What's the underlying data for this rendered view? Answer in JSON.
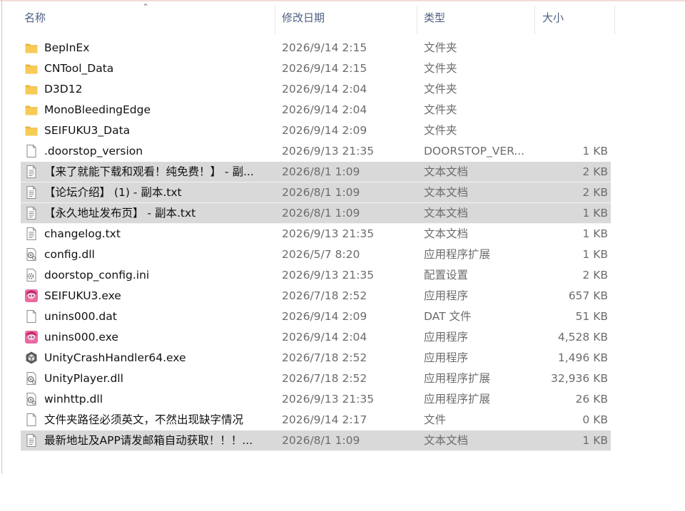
{
  "header": {
    "name": "名称",
    "date": "修改日期",
    "type": "类型",
    "size": "大小"
  },
  "files": [
    {
      "name": "BepInEx",
      "date": "2026/9/14 2:15",
      "type": "文件夹",
      "size": "",
      "icon": "folder-icon",
      "selected": false
    },
    {
      "name": "CNTool_Data",
      "date": "2026/9/14 2:15",
      "type": "文件夹",
      "size": "",
      "icon": "folder-icon",
      "selected": false
    },
    {
      "name": "D3D12",
      "date": "2026/9/14 2:04",
      "type": "文件夹",
      "size": "",
      "icon": "folder-icon",
      "selected": false
    },
    {
      "name": "MonoBleedingEdge",
      "date": "2026/9/14 2:04",
      "type": "文件夹",
      "size": "",
      "icon": "folder-icon",
      "selected": false
    },
    {
      "name": "SEIFUKU3_Data",
      "date": "2026/9/14 2:09",
      "type": "文件夹",
      "size": "",
      "icon": "folder-icon",
      "selected": false
    },
    {
      "name": ".doorstop_version",
      "date": "2026/9/13 21:35",
      "type": "DOORSTOP_VER...",
      "size": "1 KB",
      "icon": "blank-file-icon",
      "selected": false
    },
    {
      "name": "【来了就能下载和观看！纯免费！】 - 副...",
      "date": "2026/8/1 1:09",
      "type": "文本文档",
      "size": "2 KB",
      "icon": "text-file-icon",
      "selected": true
    },
    {
      "name": "【论坛介绍】 (1) - 副本.txt",
      "date": "2026/8/1 1:09",
      "type": "文本文档",
      "size": "2 KB",
      "icon": "text-file-icon",
      "selected": true
    },
    {
      "name": "【永久地址发布页】  - 副本.txt",
      "date": "2026/8/1 1:09",
      "type": "文本文档",
      "size": "1 KB",
      "icon": "text-file-icon",
      "selected": true
    },
    {
      "name": "changelog.txt",
      "date": "2026/9/13 21:35",
      "type": "文本文档",
      "size": "1 KB",
      "icon": "text-file-icon",
      "selected": false
    },
    {
      "name": "config.dll",
      "date": "2026/5/7 8:20",
      "type": "应用程序扩展",
      "size": "1 KB",
      "icon": "dll-file-icon",
      "selected": false
    },
    {
      "name": "doorstop_config.ini",
      "date": "2026/9/13 21:35",
      "type": "配置设置",
      "size": "2 KB",
      "icon": "ini-file-icon",
      "selected": false
    },
    {
      "name": "SEIFUKU3.exe",
      "date": "2026/7/18 2:52",
      "type": "应用程序",
      "size": "657 KB",
      "icon": "app-anime-icon",
      "selected": false
    },
    {
      "name": "unins000.dat",
      "date": "2026/9/14 2:09",
      "type": "DAT 文件",
      "size": "51 KB",
      "icon": "blank-file-icon",
      "selected": false
    },
    {
      "name": "unins000.exe",
      "date": "2026/9/14 2:04",
      "type": "应用程序",
      "size": "4,528 KB",
      "icon": "app-anime-icon",
      "selected": false
    },
    {
      "name": "UnityCrashHandler64.exe",
      "date": "2026/7/18 2:52",
      "type": "应用程序",
      "size": "1,496 KB",
      "icon": "unity-icon",
      "selected": false
    },
    {
      "name": "UnityPlayer.dll",
      "date": "2026/7/18 2:52",
      "type": "应用程序扩展",
      "size": "32,936 KB",
      "icon": "dll-file-icon",
      "selected": false
    },
    {
      "name": "winhttp.dll",
      "date": "2026/9/13 21:35",
      "type": "应用程序扩展",
      "size": "26 KB",
      "icon": "dll-file-icon",
      "selected": false
    },
    {
      "name": "文件夹路径必须英文，不然出现缺字情况",
      "date": "2026/9/14 2:17",
      "type": "文件",
      "size": "0 KB",
      "icon": "blank-file-icon",
      "selected": false
    },
    {
      "name": "最新地址及APP请发邮箱自动获取！！！...",
      "date": "2026/8/1 1:09",
      "type": "文本文档",
      "size": "1 KB",
      "icon": "text-file-icon",
      "selected": true
    }
  ],
  "colors": {
    "folder": "#f5c64a",
    "selection": "#d9d9d9",
    "header_text": "#4d6082"
  }
}
